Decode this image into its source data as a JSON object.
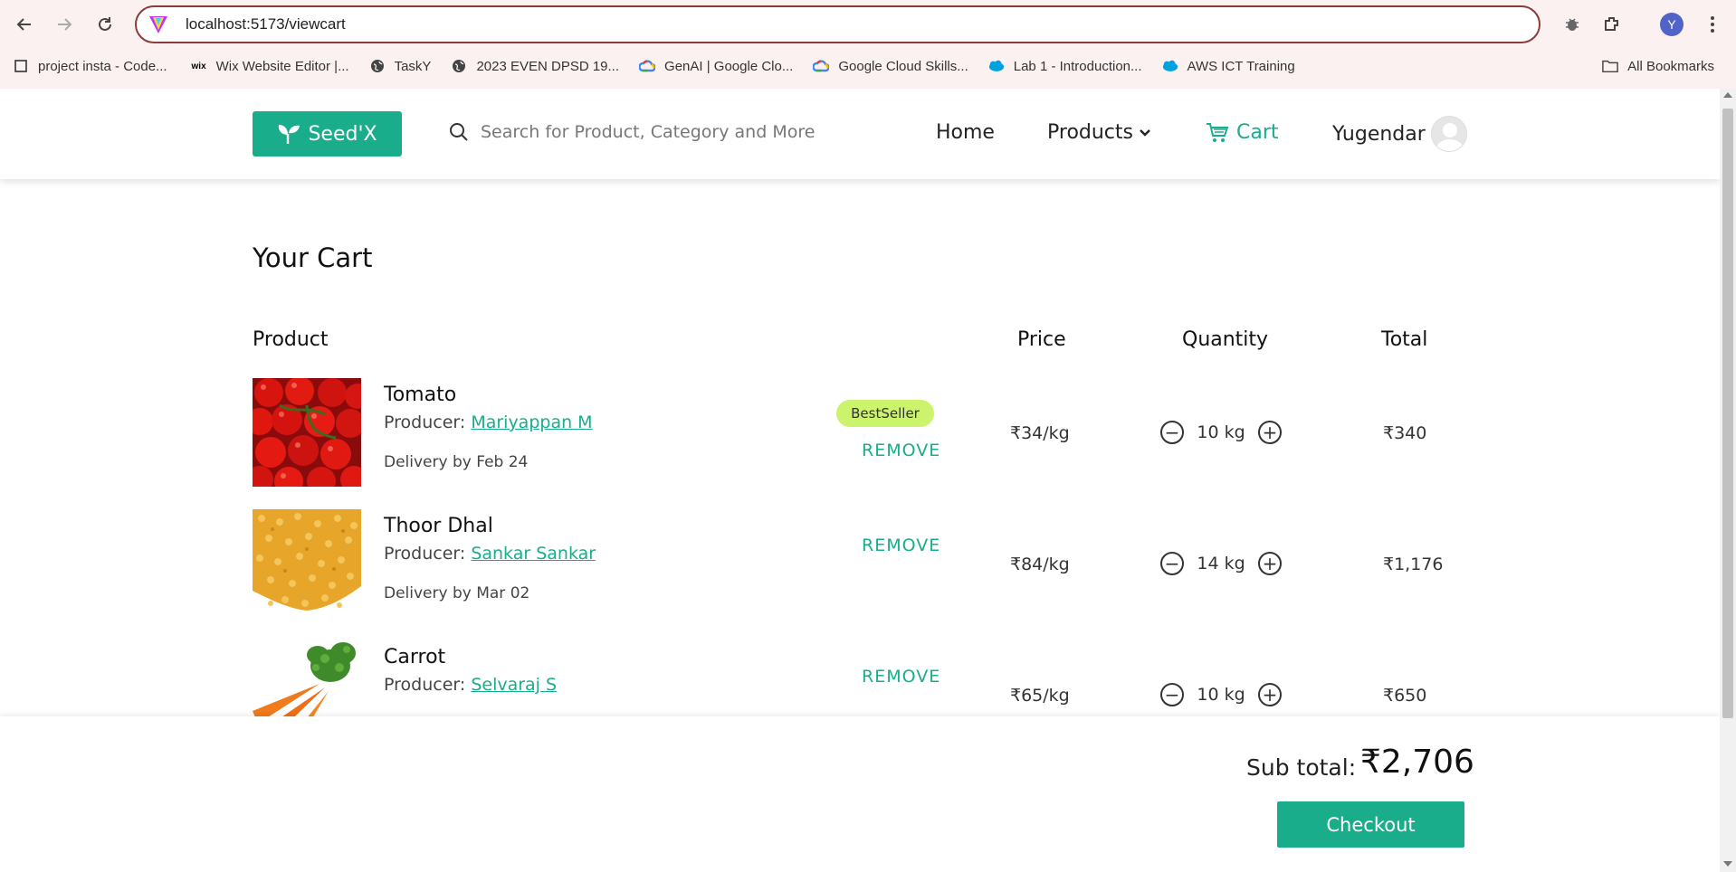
{
  "browser": {
    "url": "localhost:5173/viewcart",
    "profile_initial": "Y",
    "bookmarks": [
      {
        "label": "project insta - Code...",
        "icon": "checkbox-icon"
      },
      {
        "label": "Wix Website Editor |...",
        "icon": "wix-icon"
      },
      {
        "label": "TaskY",
        "icon": "globe-icon"
      },
      {
        "label": "2023 EVEN DPSD 19...",
        "icon": "globe-icon"
      },
      {
        "label": "GenAI | Google Clo...",
        "icon": "google-cloud-icon"
      },
      {
        "label": "Google Cloud Skills...",
        "icon": "google-cloud-icon"
      },
      {
        "label": "Lab 1 - Introduction...",
        "icon": "salesforce-icon"
      },
      {
        "label": "AWS ICT Training",
        "icon": "salesforce-icon"
      }
    ],
    "all_bookmarks": "All Bookmarks"
  },
  "header": {
    "brand": "Seed'X",
    "search_placeholder": "Search for Product, Category and More",
    "nav_home": "Home",
    "nav_products": "Products",
    "nav_cart": "Cart",
    "user_name": "Yugendar"
  },
  "cart": {
    "title": "Your Cart",
    "columns": {
      "product": "Product",
      "price": "Price",
      "quantity": "Quantity",
      "total": "Total"
    },
    "producer_label": "Producer: ",
    "remove_label": "REMOVE",
    "items": [
      {
        "name": "Tomato",
        "producer": "Mariyappan M",
        "delivery": "Delivery by Feb 24",
        "badge": "BestSeller",
        "price": "₹34/kg",
        "quantity": "10 kg",
        "total": "₹340"
      },
      {
        "name": "Thoor Dhal",
        "producer": "Sankar Sankar",
        "delivery": "Delivery by Mar 02",
        "badge": "",
        "price": "₹84/kg",
        "quantity": "14 kg",
        "total": "₹1,176"
      },
      {
        "name": "Carrot",
        "producer": "Selvaraj S",
        "delivery": "",
        "badge": "",
        "price": "₹65/kg",
        "quantity": "10 kg",
        "total": "₹650"
      }
    ]
  },
  "summary": {
    "subtotal_label": "Sub total:",
    "subtotal_value": "₹2,706",
    "checkout_label": "Checkout"
  },
  "colors": {
    "brand": "#1aad8b",
    "badge": "#ccf36c",
    "omnibox_border": "#8c3a3a"
  }
}
